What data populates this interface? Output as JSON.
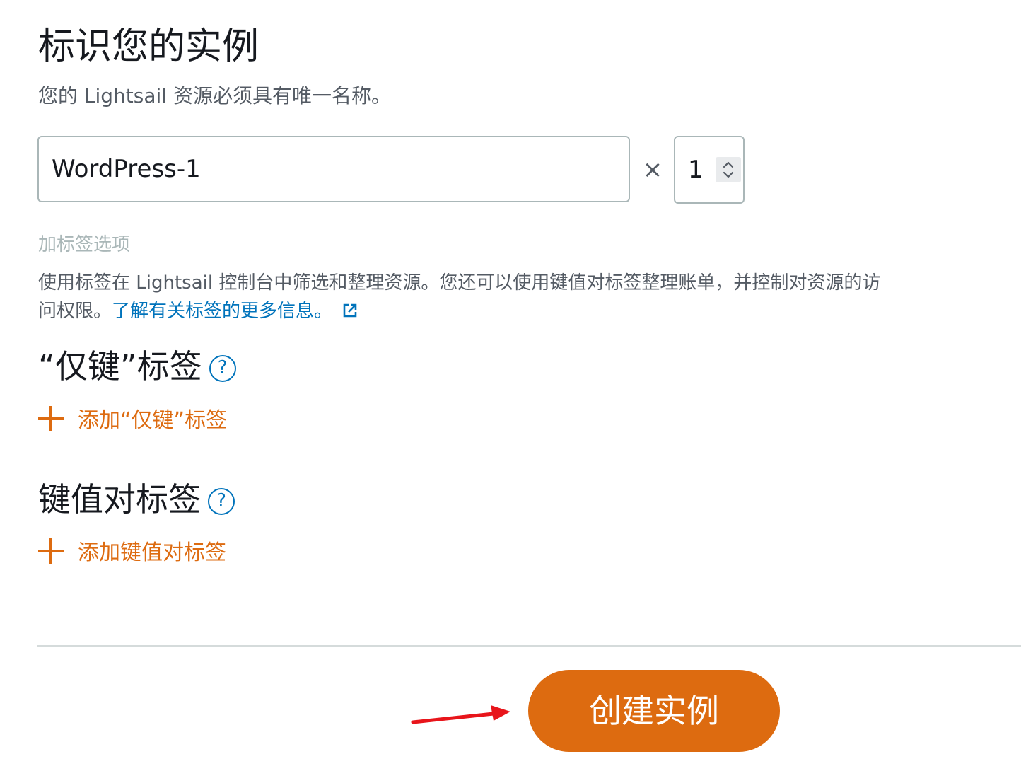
{
  "header": {
    "title": "标识您的实例",
    "subtitle": "您的 Lightsail 资源必须具有唯一名称。"
  },
  "instance_name": {
    "value": "WordPress-1"
  },
  "quantity": {
    "multiplier_symbol": "×",
    "value": "1"
  },
  "tags": {
    "options_label": "加标签选项",
    "description": "使用标签在 Lightsail 控制台中筛选和整理资源。您还可以使用键值对标签整理账单，并控制对资源的访问权限。",
    "learn_more_link": "了解有关标签的更多信息。"
  },
  "key_only_tags": {
    "heading": "“仅键”标签",
    "help_symbol": "?",
    "add_label": "添加“仅键”标签"
  },
  "key_value_tags": {
    "heading": "键值对标签",
    "help_symbol": "?",
    "add_label": "添加键值对标签"
  },
  "footer": {
    "create_button_label": "创建实例"
  },
  "colors": {
    "accent_orange": "#dd6b10",
    "link_blue": "#0073bb",
    "annotation_red": "#e8151b"
  },
  "icons": {
    "external_link": "external-link-icon",
    "help": "help-icon",
    "plus": "plus-icon",
    "spinner": "chevron-up-down-icon"
  }
}
